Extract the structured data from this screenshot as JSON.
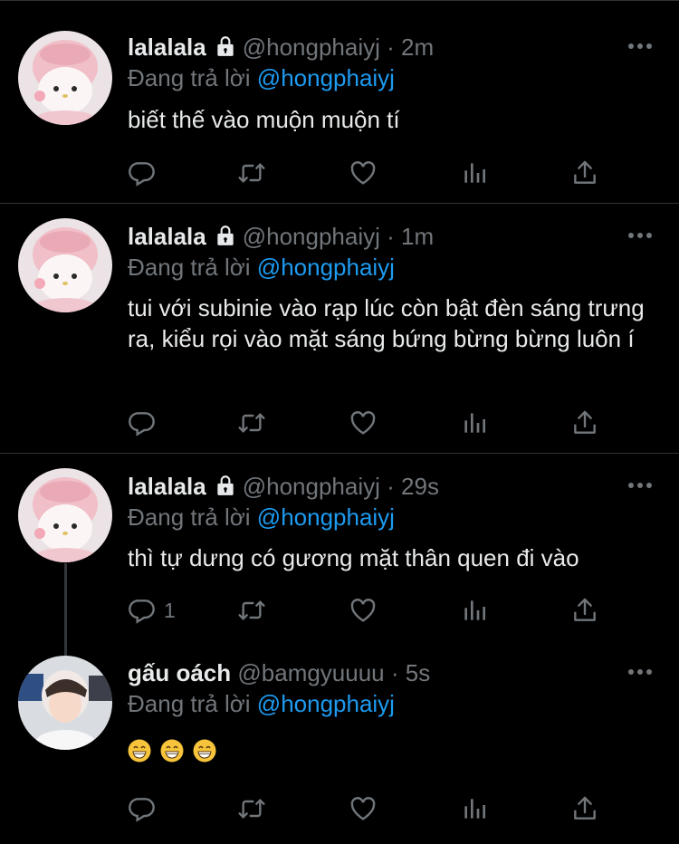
{
  "tweets": [
    {
      "name": "lalalala",
      "handle": "@hongphaiyj",
      "time": "· 2m",
      "reply_prefix": "Đang trả lời",
      "reply_to": "@hongphaiyj",
      "text": "biết thế vào muộn muộn tí",
      "reply_count": "",
      "avatar_icon": "pink-melody-plush-avatar"
    },
    {
      "name": "lalalala",
      "handle": "@hongphaiyj",
      "time": "· 1m",
      "reply_prefix": "Đang trả lời",
      "reply_to": "@hongphaiyj",
      "text": "tui với subinie vào rạp lúc còn bật đèn sáng trưng ra, kiểu rọi vào mặt sáng bứng bừng bừng luôn í",
      "reply_count": "",
      "avatar_icon": "pink-melody-plush-avatar"
    },
    {
      "name": "lalalala",
      "handle": "@hongphaiyj",
      "time": "· 29s",
      "reply_prefix": "Đang trả lời",
      "reply_to": "@hongphaiyj",
      "text": "thì tự dưng có gương mặt thân quen đi vào",
      "reply_count": "1",
      "avatar_icon": "pink-melody-plush-avatar"
    },
    {
      "name": "gấu oách",
      "handle": "@bamgyuuuu",
      "time": "· 5s",
      "reply_prefix": "Đang trả lời",
      "reply_to": "@hongphaiyj",
      "text": "",
      "emojis": [
        "grinning-face-emoji",
        "grinning-face-emoji",
        "grinning-face-emoji"
      ],
      "reply_count": "",
      "avatar_icon": "person-photo-avatar"
    }
  ],
  "colors": {
    "background": "#000000",
    "text": "#e7e9ea",
    "muted": "#71767b",
    "mention": "#1d9bf0",
    "divider": "#2f3336"
  },
  "icons": [
    "reply-icon",
    "retweet-icon",
    "like-icon",
    "views-icon",
    "share-icon",
    "more-icon",
    "lock-icon"
  ]
}
